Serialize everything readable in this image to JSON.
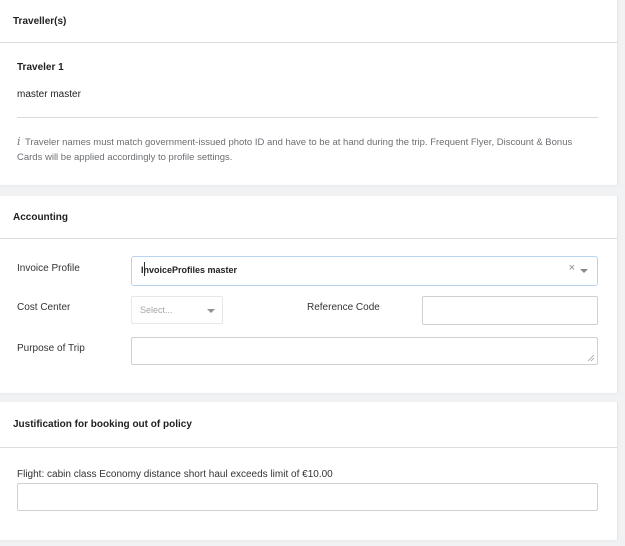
{
  "traveller": {
    "section_title": "Traveller(s)",
    "traveler_title": "Traveler 1",
    "traveler_name": "master master",
    "info_icon": "info-icon",
    "info_text": "Traveler names must match government-issued photo ID and have to be at hand during the trip. Frequent Flyer, Discount & Bonus Cards will be applied accordingly to profile settings."
  },
  "accounting": {
    "section_title": "Accounting",
    "invoice_profile_label": "Invoice Profile",
    "invoice_profile_value": "InvoiceProfiles master",
    "clear_symbol": "×",
    "cost_center_label": "Cost Center",
    "cost_center_placeholder": "Select...",
    "reference_code_label": "Reference Code",
    "reference_code_value": "",
    "purpose_label": "Purpose of Trip",
    "purpose_value": ""
  },
  "justification": {
    "section_title": "Justification for booking out of policy",
    "flight_text": "Flight: cabin class Economy distance short haul exceeds limit of €10.00",
    "flight_value": ""
  },
  "colors": {
    "page_background": "#f1f2f3",
    "card_background": "#ffffff",
    "select_focus_border": "#b9d2ee"
  }
}
